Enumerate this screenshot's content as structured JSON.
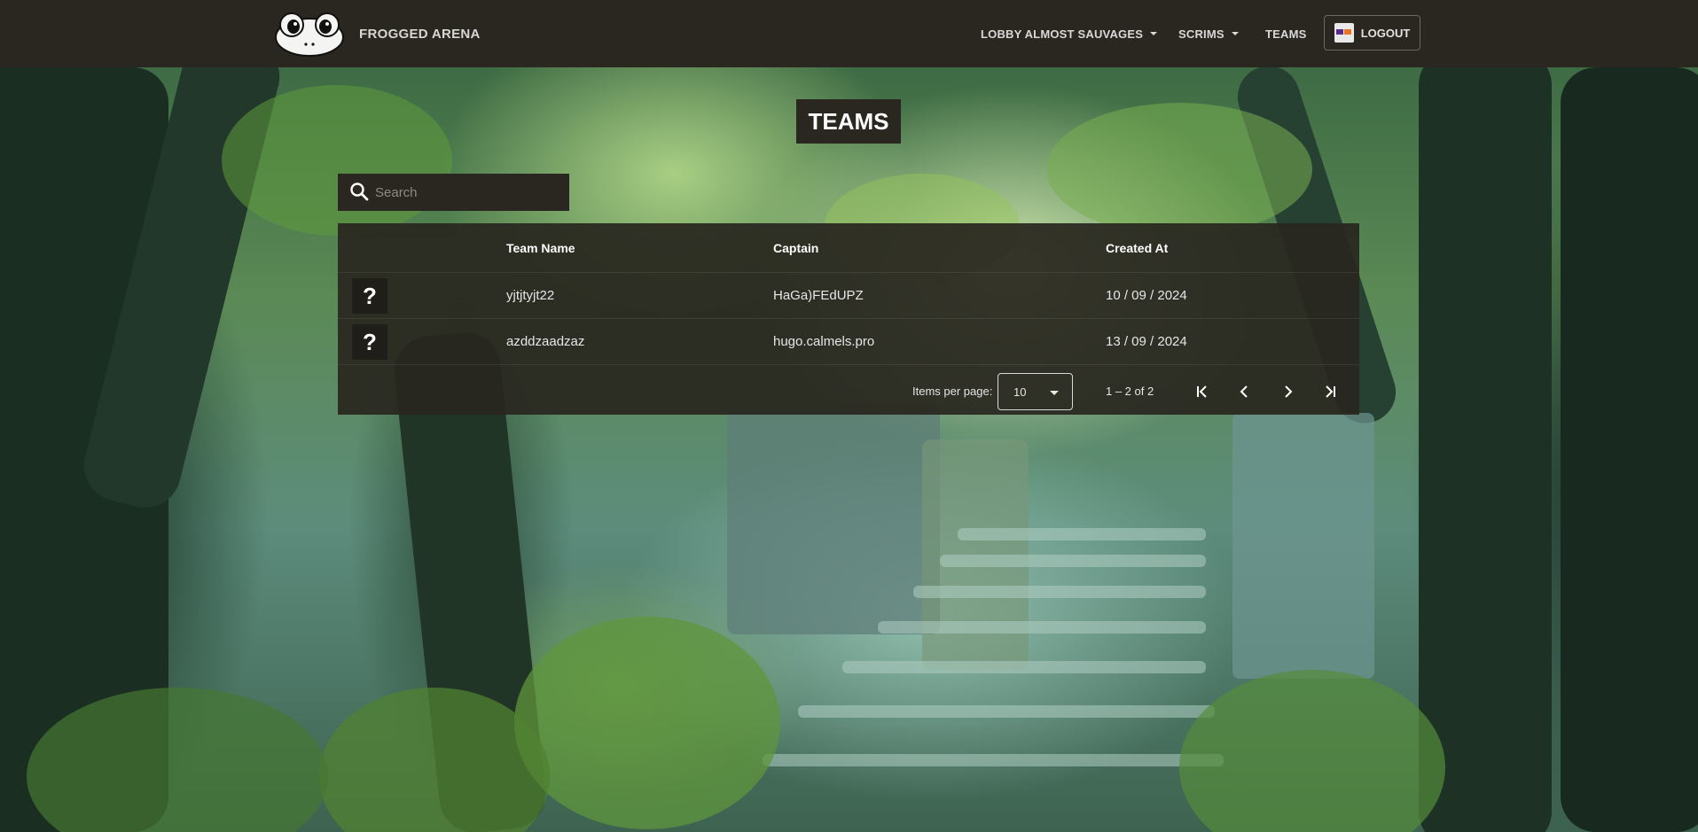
{
  "navbar": {
    "brand": "FROGGED ARENA",
    "links": [
      {
        "label": "LOBBY ALMOST SAUVAGES",
        "dropdown": true
      },
      {
        "label": "SCRIMS",
        "dropdown": true
      },
      {
        "label": "TEAMS",
        "dropdown": false
      }
    ],
    "logout_label": "LOGOUT"
  },
  "page": {
    "title": "TEAMS"
  },
  "search": {
    "placeholder": "Search",
    "value": ""
  },
  "table": {
    "columns": [
      "Team Name",
      "Captain",
      "Created At"
    ],
    "rows": [
      {
        "avatar": "?",
        "team_name": "yjtjtyjt22",
        "captain": "HaGa)FEdUPZ",
        "created_at": "10 / 09 / 2024"
      },
      {
        "avatar": "?",
        "team_name": "azddzaadzaz",
        "captain": "hugo.calmels.pro",
        "created_at": "13 / 09 / 2024"
      }
    ]
  },
  "paginator": {
    "items_per_page_label": "Items per page:",
    "items_per_page": "10",
    "range": "1 – 2 of 2"
  },
  "colors": {
    "panel": "#29271f",
    "text": "#ffffff"
  },
  "icons": [
    "frog-logo-icon",
    "search-icon",
    "first-page-icon",
    "prev-page-icon",
    "next-page-icon",
    "last-page-icon",
    "dropdown-arrow-icon",
    "user-avatar-icon"
  ]
}
